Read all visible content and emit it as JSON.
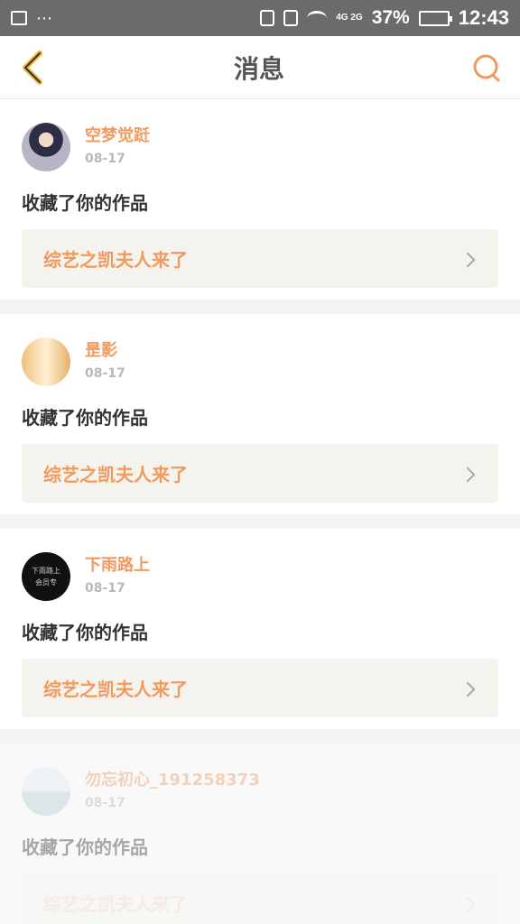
{
  "status_bar": {
    "left_icons": [
      "image-icon",
      "more-icon"
    ],
    "right_icons": [
      "touch-icon",
      "portrait-icon",
      "wifi-icon"
    ],
    "network": "4G 2G",
    "battery_percent": "37%",
    "battery_level": 0.37,
    "time": "12:43"
  },
  "nav": {
    "title": "消息",
    "back_icon": "chevron-left-icon",
    "search_icon": "search-icon"
  },
  "messages": [
    {
      "user": "空梦觉跹",
      "date": "08-17",
      "action": "收藏了你的作品",
      "work": "综艺之凯夫人来了",
      "avatar": {
        "line1": "",
        "line2": ""
      }
    },
    {
      "user": "昰影",
      "date": "08-17",
      "action": "收藏了你的作品",
      "work": "综艺之凯夫人来了",
      "avatar": {
        "line1": "",
        "line2": ""
      }
    },
    {
      "user": "下雨路上",
      "date": "08-17",
      "action": "收藏了你的作品",
      "work": "综艺之凯夫人来了",
      "avatar": {
        "line1": "下雨路上",
        "line2": "会员专"
      }
    },
    {
      "user": "勿忘初心_191258373",
      "date": "08-17",
      "action": "收藏了你的作品",
      "work": "综艺之凯夫人来了",
      "avatar": {
        "line1": "",
        "line2": ""
      }
    }
  ],
  "colors": {
    "accent": "#f29a5e",
    "back_icon": "#f0b43a",
    "card_link_bg": "#f4f3ee",
    "status_bar": "#6b6b6b"
  }
}
